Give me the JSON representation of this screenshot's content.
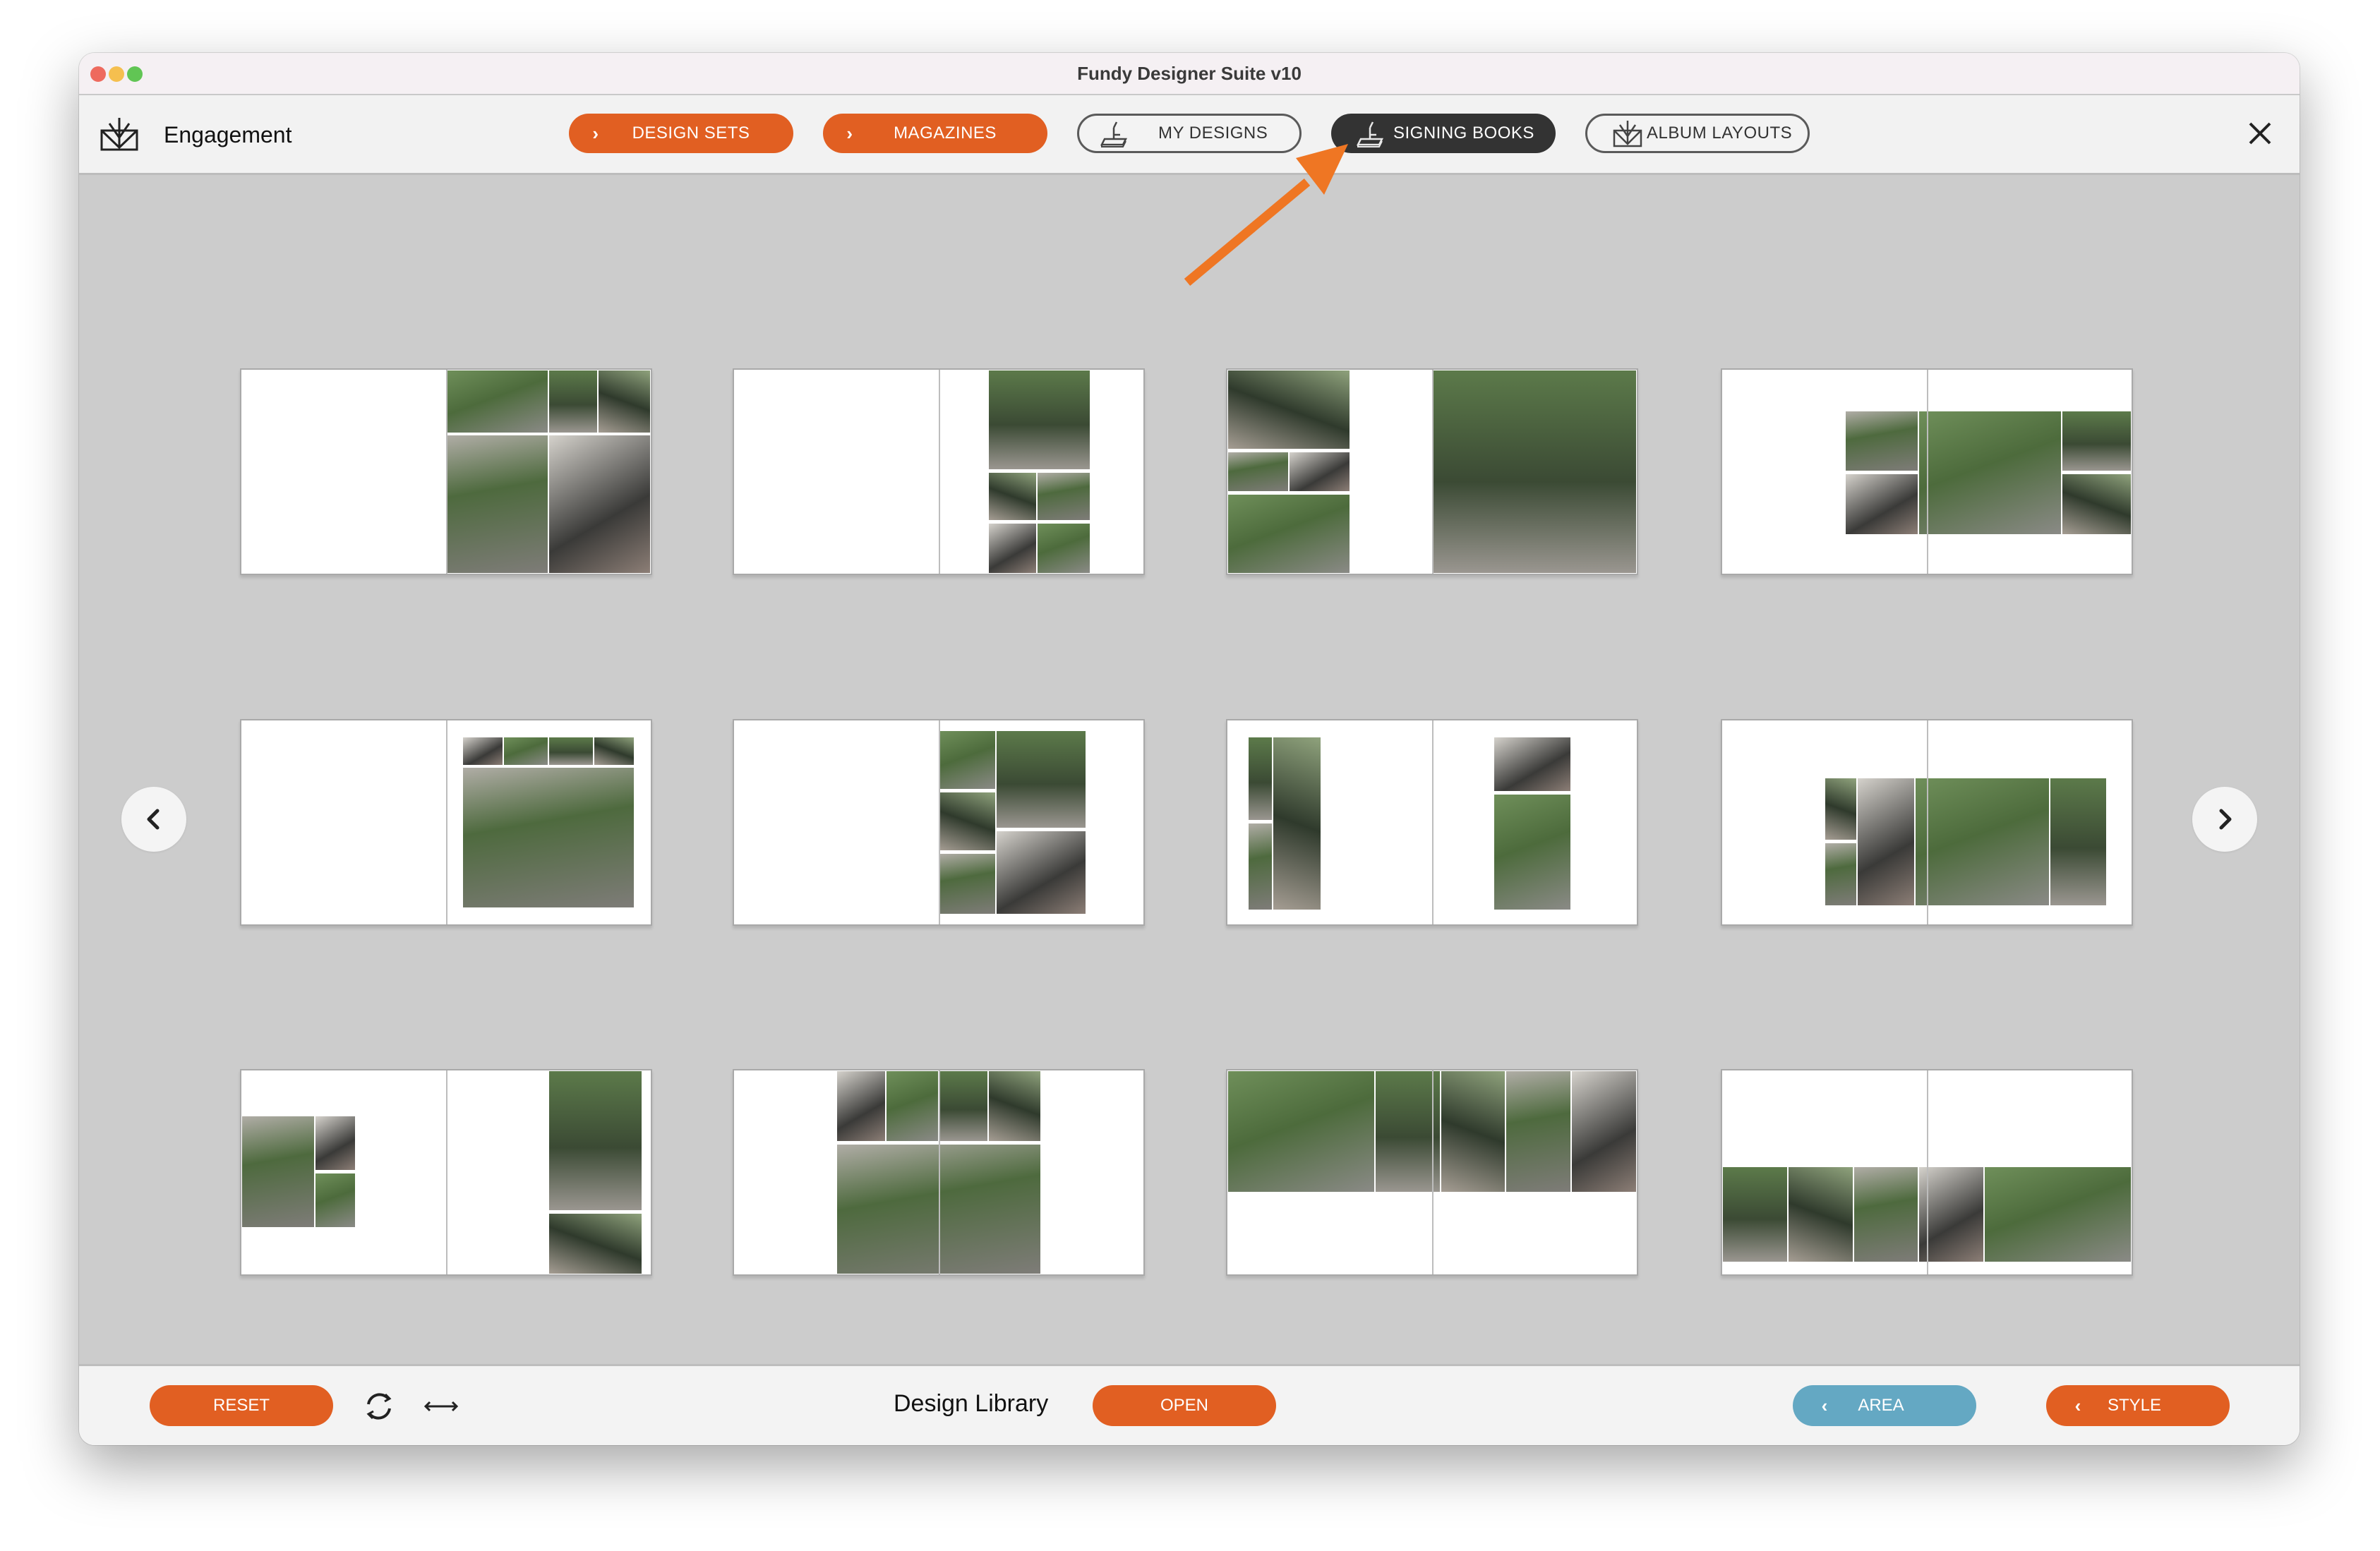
{
  "window": {
    "title": "Fundy Designer Suite v10"
  },
  "toolbar": {
    "project_name": "Engagement",
    "project_icon": "album-icon",
    "tabs": [
      {
        "label": "DESIGN SETS",
        "style": "orange",
        "icon": "chevron-right-icon",
        "active": false
      },
      {
        "label": "MAGAZINES",
        "style": "orange",
        "icon": "chevron-right-icon",
        "active": false
      },
      {
        "label": "MY DESIGNS",
        "style": "outline",
        "icon": "signing-book-icon",
        "active": false
      },
      {
        "label": "SIGNING BOOKS",
        "style": "dark",
        "icon": "signing-book-icon",
        "active": true
      },
      {
        "label": "ALBUM LAYOUTS",
        "style": "outline",
        "icon": "album-icon",
        "active": false
      }
    ],
    "close_icon": "close-icon"
  },
  "annotation": {
    "type": "arrow",
    "color": "#ef7623",
    "points_to": "SIGNING BOOKS"
  },
  "gallery": {
    "prev_icon": "chevron-left-icon",
    "next_icon": "chevron-right-icon",
    "spreads": [
      {
        "id": 1,
        "content": "photo spread"
      },
      {
        "id": 2,
        "content": "photo spread"
      },
      {
        "id": 3,
        "content": "photo spread"
      },
      {
        "id": 4,
        "content": "photo spread"
      },
      {
        "id": 5,
        "content": "photo spread"
      },
      {
        "id": 6,
        "content": "photo spread"
      },
      {
        "id": 7,
        "content": "photo spread"
      },
      {
        "id": 8,
        "content": "photo spread"
      },
      {
        "id": 9,
        "content": "photo spread"
      },
      {
        "id": 10,
        "content": "photo spread"
      },
      {
        "id": 11,
        "content": "photo spread"
      },
      {
        "id": 12,
        "content": "photo spread"
      }
    ]
  },
  "bottombar": {
    "reset_label": "RESET",
    "refresh_icon": "refresh-icon",
    "resize_icon": "horizontal-arrows-icon",
    "section_title": "Design Library",
    "open_label": "OPEN",
    "area_label": "AREA",
    "style_label": "STYLE"
  },
  "colors": {
    "accent_orange": "#e15f22",
    "accent_blue": "#64a8c3",
    "active_tab": "#333333",
    "content_bg": "#cccccc"
  }
}
